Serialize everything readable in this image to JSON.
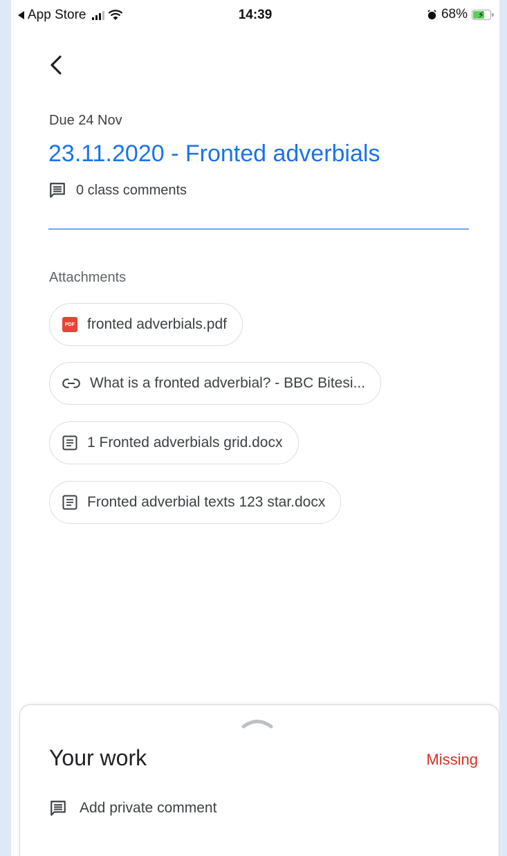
{
  "status_bar": {
    "back_app": "App Store",
    "time": "14:39",
    "battery_percent": "68%",
    "battery_level": 0.68,
    "charging_color": "#5ad05a"
  },
  "nav": {
    "back_icon": "chevron-left-icon"
  },
  "assignment": {
    "due": "Due 24 Nov",
    "title": "23.11.2020 - Fronted adverbials",
    "title_color": "#1a73e8",
    "class_comments": "0 class comments"
  },
  "attachments": {
    "label": "Attachments",
    "items": [
      {
        "name": "fronted adverbials.pdf",
        "icon": "pdf-icon",
        "icon_text": "PDF"
      },
      {
        "name": "What is a fronted adverbial? - BBC Bitesi...",
        "icon": "link-icon"
      },
      {
        "name": "1 Fronted adverbials grid.docx",
        "icon": "document-icon"
      },
      {
        "name": "Fronted adverbial texts 123 star.docx",
        "icon": "document-icon"
      }
    ]
  },
  "your_work": {
    "title": "Your work",
    "status": "Missing",
    "status_color": "#d93025",
    "private_comment": "Add private comment"
  }
}
